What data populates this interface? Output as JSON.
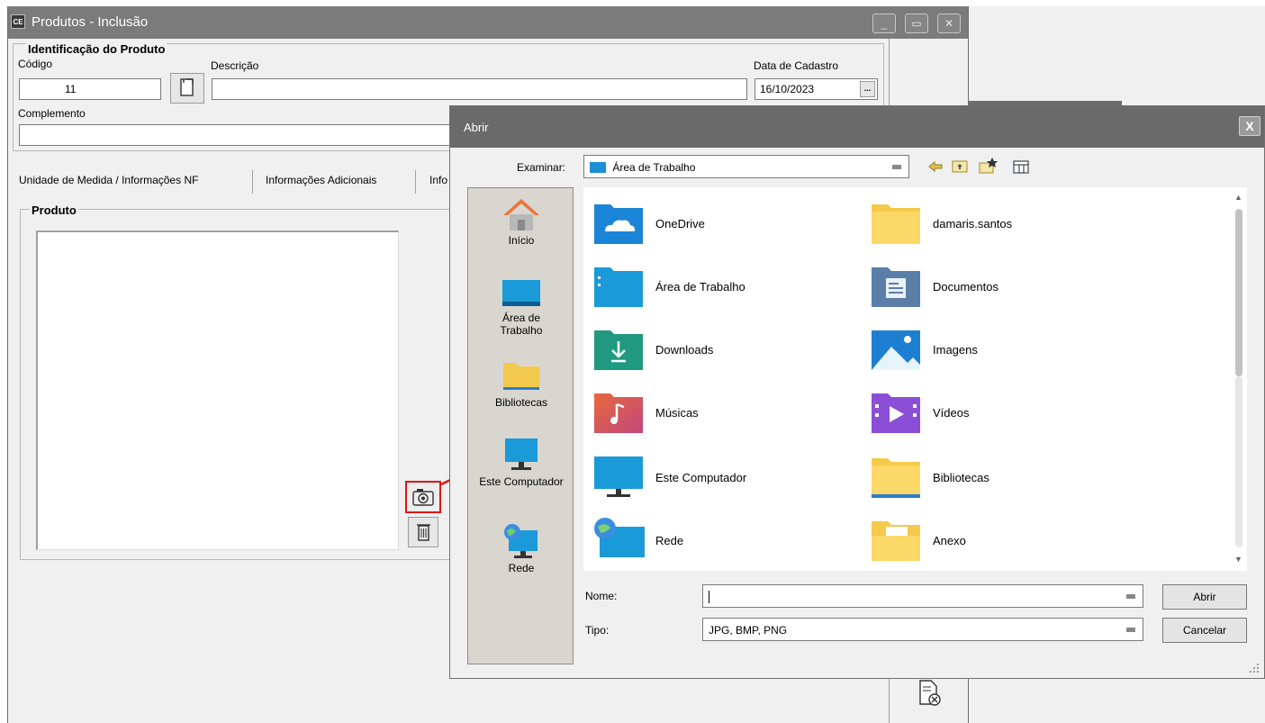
{
  "window": {
    "app_icon": "CE",
    "title": "Produtos - Inclusão",
    "controls": [
      "minimize-icon",
      "maximize-icon",
      "close-icon"
    ]
  },
  "identificacao": {
    "group_title": "Identificação do Produto",
    "codigo_label": "Código",
    "codigo_value": "11",
    "descricao_label": "Descrição",
    "descricao_value": "",
    "data_label": "Data de Cadastro",
    "data_value": "16/10/2023",
    "data_button": "...",
    "complemento_label": "Complemento",
    "complemento_value": ""
  },
  "tabs": [
    {
      "label": "Unidade de Medida / Informações NF"
    },
    {
      "label": "Informações Adicionais"
    },
    {
      "label": "Info"
    }
  ],
  "produto": {
    "group_title": "Produto",
    "camera_icon": "camera-icon",
    "trash_icon": "trash-icon"
  },
  "dialog": {
    "title": "Abrir",
    "close": "X",
    "examinar_label": "Examinar:",
    "examinar_value": "Área de Trabalho",
    "toolbar_icons": [
      "back-icon",
      "up-folder-icon",
      "new-folder-icon",
      "view-menu-icon"
    ],
    "places": [
      {
        "label": "Início",
        "icon": "home-icon"
      },
      {
        "label": "Área de Trabalho",
        "icon": "desktop-icon"
      },
      {
        "label": "Bibliotecas",
        "icon": "libraries-icon"
      },
      {
        "label": "Este Computador",
        "icon": "computer-icon"
      },
      {
        "label": "Rede",
        "icon": "network-icon"
      }
    ],
    "files": [
      {
        "name": "OneDrive",
        "icon": "onedrive-icon"
      },
      {
        "name": "damaris.santos",
        "icon": "folder-icon"
      },
      {
        "name": "Área de Trabalho",
        "icon": "desktop-folder-icon"
      },
      {
        "name": "Documentos",
        "icon": "documents-icon"
      },
      {
        "name": "Downloads",
        "icon": "downloads-icon"
      },
      {
        "name": "Imagens",
        "icon": "pictures-icon"
      },
      {
        "name": "Músicas",
        "icon": "music-icon"
      },
      {
        "name": "Vídeos",
        "icon": "videos-icon"
      },
      {
        "name": "Este Computador",
        "icon": "computer-icon"
      },
      {
        "name": "Bibliotecas",
        "icon": "folder-icon"
      },
      {
        "name": "Rede",
        "icon": "network-icon"
      },
      {
        "name": "Anexo",
        "icon": "folder-icon"
      }
    ],
    "nome_label": "Nome:",
    "nome_value": "",
    "tipo_label": "Tipo:",
    "tipo_value": "JPG, BMP, PNG",
    "abrir_button": "Abrir",
    "cancelar_button": "Cancelar"
  },
  "colors": {
    "highlight": "#e01414",
    "arrow": "#e01414"
  }
}
